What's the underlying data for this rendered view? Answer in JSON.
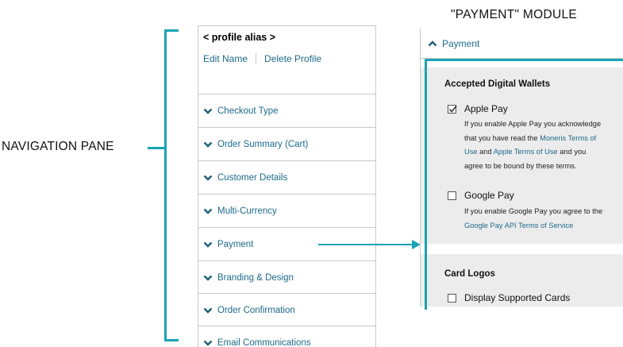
{
  "annotations": {
    "nav_pane_label": "NAVIGATION PANE",
    "module_label": "\"PAYMENT\" MODULE",
    "accent_color": "#1aa3b3"
  },
  "nav": {
    "alias": "< profile alias >",
    "edit_name": "Edit Name",
    "delete_profile": "Delete Profile",
    "items": [
      {
        "label": "Checkout Type",
        "icon": "chevron-down-icon"
      },
      {
        "label": "Order Summary (Cart)",
        "icon": "chevron-down-icon"
      },
      {
        "label": "Customer Details",
        "icon": "chevron-down-icon"
      },
      {
        "label": "Multi-Currency",
        "icon": "chevron-down-icon"
      },
      {
        "label": "Payment",
        "icon": "chevron-down-icon"
      },
      {
        "label": "Branding & Design",
        "icon": "chevron-down-icon"
      },
      {
        "label": "Order Confirmation",
        "icon": "chevron-down-icon"
      },
      {
        "label": "Email Communications",
        "icon": "chevron-down-icon"
      }
    ]
  },
  "payment": {
    "header": "Payment",
    "header_icon": "chevron-up-icon",
    "wallets_title": "Accepted Digital Wallets",
    "apple": {
      "label": "Apple Pay",
      "checked": true,
      "desc_1": "If you enable Apple Pay you acknowledge",
      "desc_2": "that you have read the ",
      "link_moneris": "Moneris Terms of",
      "link_moneris_2": "Use",
      "desc_3": " and ",
      "link_apple": "Apple Terms of Use",
      "desc_4": " and you",
      "desc_5": "agree to be bound by these terms."
    },
    "google": {
      "label": "Google Pay",
      "checked": false,
      "desc_1": "If you enable Google Pay you agree to the",
      "link_google": "Google Pay API Terms of Service"
    },
    "card_logos_title": "Card Logos",
    "display_cards": {
      "label": "Display Supported Cards",
      "checked": false
    }
  }
}
